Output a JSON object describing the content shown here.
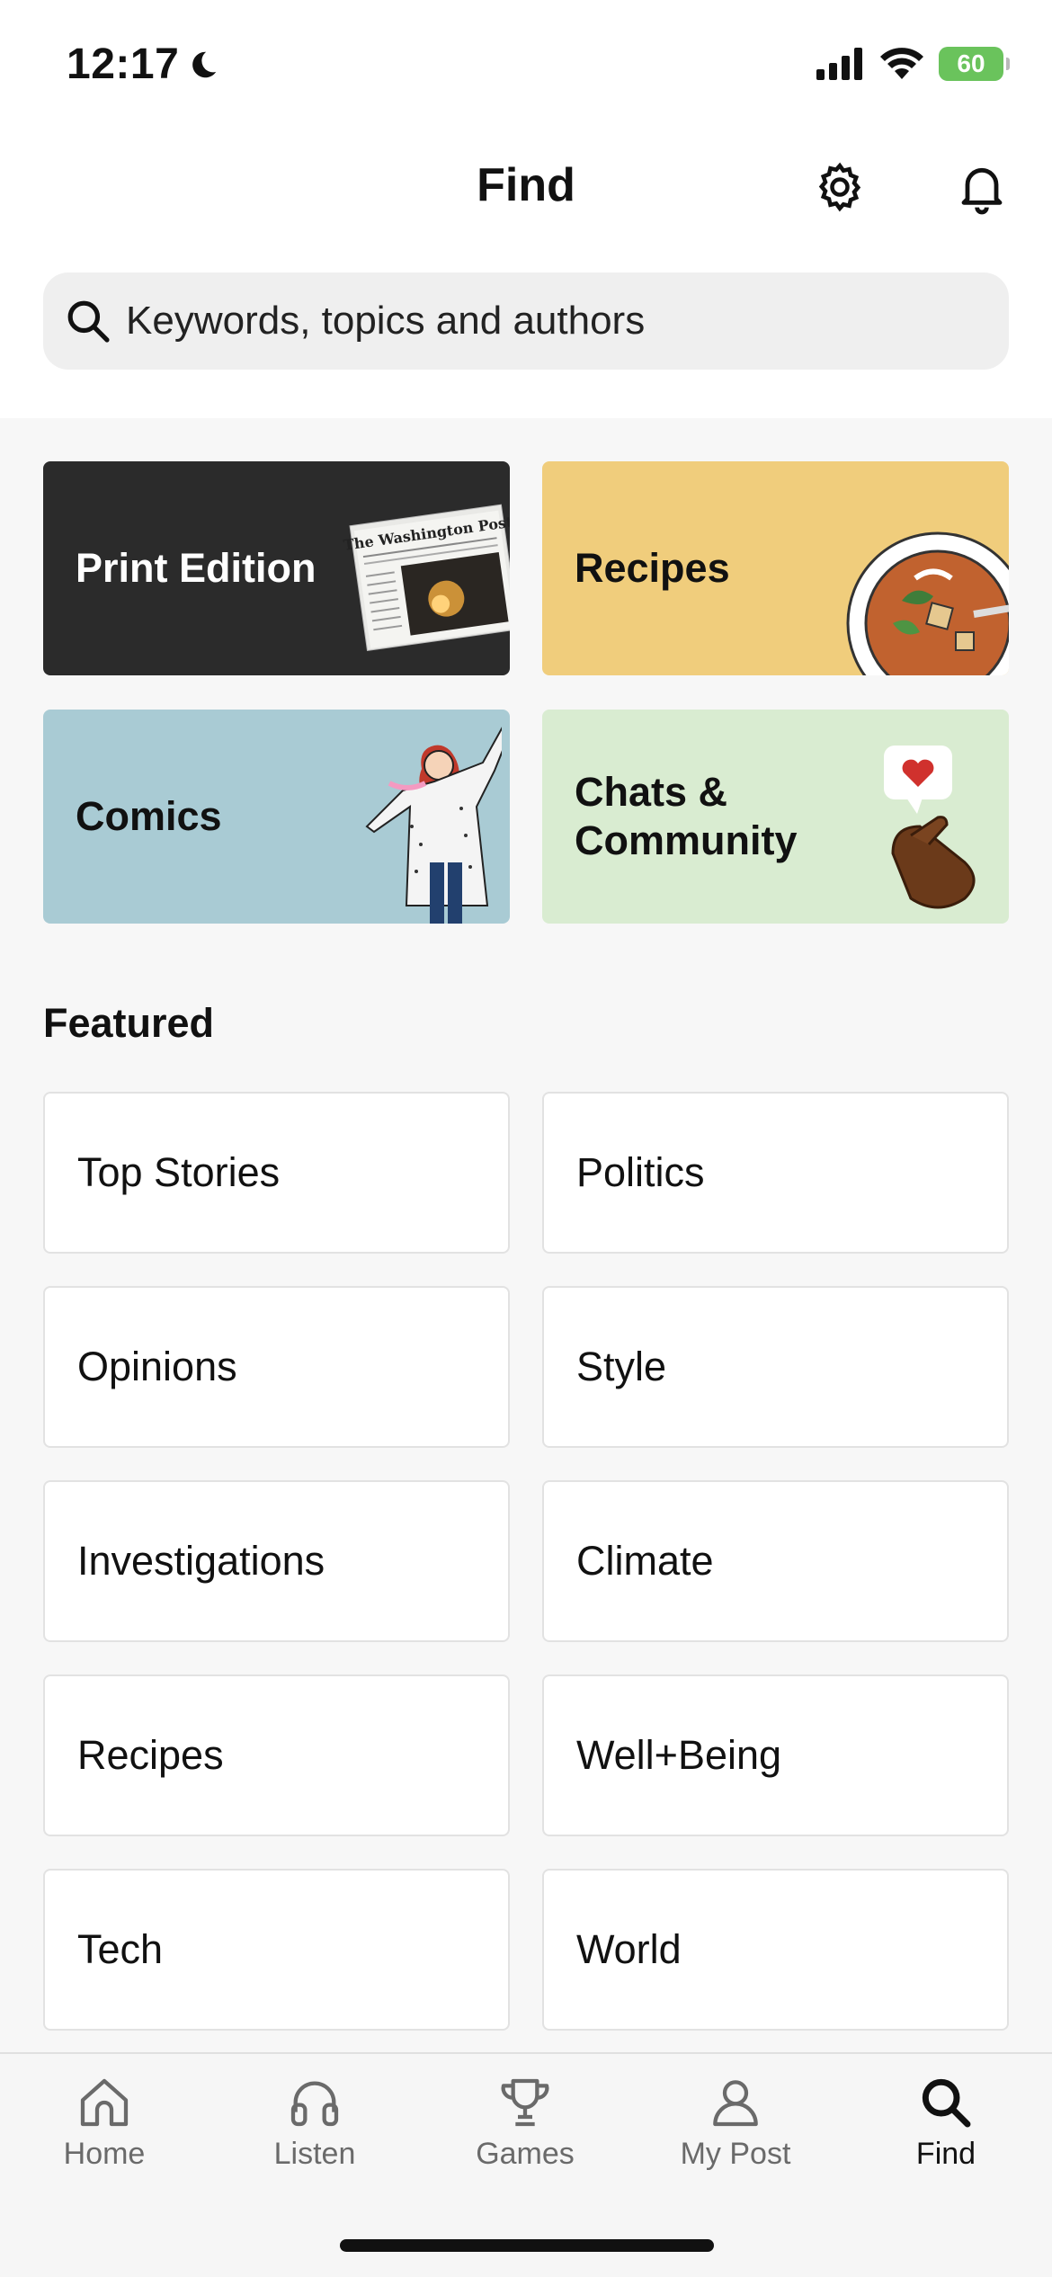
{
  "status_bar": {
    "time": "12:17",
    "battery": "60"
  },
  "header": {
    "title": "Find"
  },
  "search": {
    "placeholder": "Keywords, topics and authors"
  },
  "feature_tiles": [
    {
      "label": "Print Edition",
      "color": "#2b2b2b"
    },
    {
      "label": "Recipes",
      "color": "#f0cd7c"
    },
    {
      "label": "Comics",
      "color": "#a9cbd4"
    },
    {
      "label": "Chats & Community",
      "color": "#d9ecd1"
    }
  ],
  "newspaper": {
    "masthead": "The Washington Post"
  },
  "featured": {
    "heading": "Featured",
    "items": [
      "Top Stories",
      "Politics",
      "Opinions",
      "Style",
      "Investigations",
      "Climate",
      "Recipes",
      "Well+Being",
      "Tech",
      "World"
    ]
  },
  "tab_bar": {
    "tabs": [
      {
        "label": "Home",
        "icon": "home-icon"
      },
      {
        "label": "Listen",
        "icon": "headphones-icon"
      },
      {
        "label": "Games",
        "icon": "trophy-icon"
      },
      {
        "label": "My Post",
        "icon": "person-icon"
      },
      {
        "label": "Find",
        "icon": "search-icon",
        "active": true
      }
    ]
  }
}
